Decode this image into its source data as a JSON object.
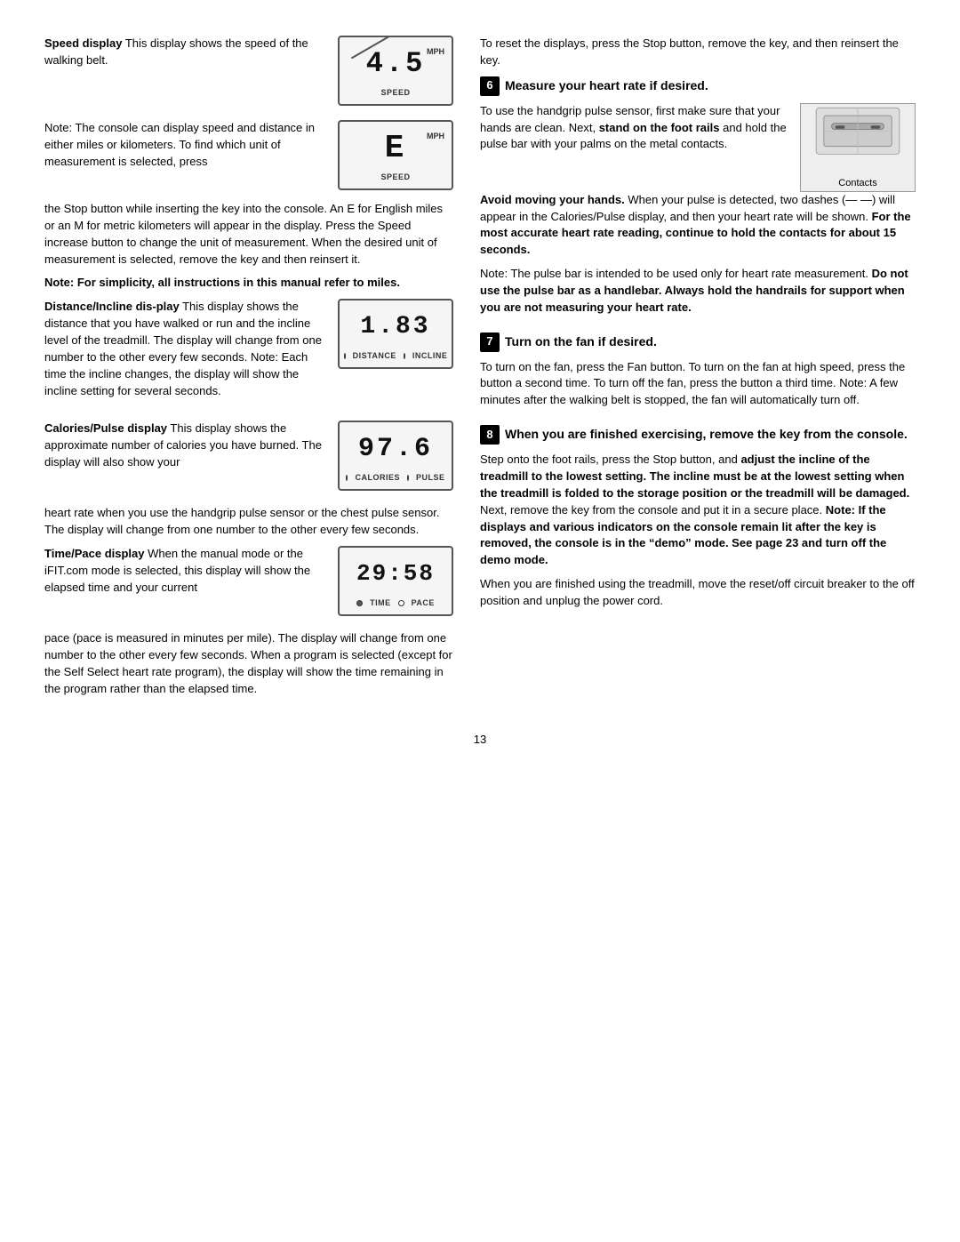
{
  "page": {
    "number": "13"
  },
  "left": {
    "speed_display_heading": "Speed display",
    "speed_display_text": "This display shows the speed of the walking belt.",
    "speed_digits": "4.5",
    "speed_unit": "MPH",
    "speed_label": "SPEED",
    "note_para1": "Note: The console can display speed and distance in either miles or kilometers. To find which unit of measurement is selected, press",
    "e_digits": "E",
    "e_unit": "MPH",
    "e_label": "SPEED",
    "note_para2": "the Stop button while inserting the key into the console. An  E  for English miles or an  M  for metric kilometers will appear in the display. Press the Speed increase button to change the unit of measurement. When the desired unit of measurement is selected, remove the key and then reinsert it.",
    "note_bold": "Note: For simplicity, all instructions in this manual refer to miles.",
    "distance_heading": "Distance/Incline dis-play",
    "distance_text": "This display shows the distance that you have walked or run and the incline level of the treadmill. The display will change from one number to the other every few seconds. Note: Each time the incline changes, the display will show the incline setting for several seconds.",
    "distance_digits": "1.83",
    "distance_label_left": "DISTANCE",
    "distance_label_right": "INCLINE",
    "calories_heading": "Calories/Pulse",
    "calories_subheading": "display",
    "calories_text1": "This display shows the approximate number of calories you have burned. The display will also show your",
    "calories_digits": "97.6",
    "calories_label_left": "CALORIES",
    "calories_label_right": "PULSE",
    "calories_text2": "heart rate when you use the handgrip pulse sensor or the chest pulse sensor. The display will change from one number to the other every few seconds.",
    "time_heading": "Time/Pace display",
    "time_text1": "When the manual mode or the iFIT.com mode is selected, this display will show the elapsed time and your current",
    "time_digits": "29:58",
    "time_label_left": "TIME",
    "time_label_right": "PACE",
    "time_text2": "pace (pace is measured in minutes per mile). The display will change from one number to the other every few seconds. When a program is selected (except for the Self Select heart rate program), the display will show the time remaining in the program rather than the elapsed time."
  },
  "right": {
    "reset_text": "To reset the displays, press the Stop button, remove the key, and then reinsert the key.",
    "step6_label": "6",
    "step6_heading": "Measure your heart rate if desired.",
    "step6_para1": "To use the handgrip pulse sensor, first make sure that your hands are clean. Next,",
    "step6_bold1": "stand on the foot rails",
    "step6_para2": "and hold the pulse bar with your palms on the metal contacts.",
    "contacts_label": "Contacts",
    "step6_bold2": "Avoid moving your hands.",
    "step6_para3": "When your pulse is detected, two dashes (— —) will appear in the Calories/Pulse display, and then your heart rate will be shown.",
    "step6_bold3": "For the most accurate heart rate reading, continue to hold the contacts for about 15 seconds.",
    "pulse_bar_note_bold": "Do not use the pulse bar as a handlebar. Always hold the handrails for support when you are not measuring your heart rate.",
    "pulse_bar_note_prefix": "Note: The pulse bar is intended to be used only for heart rate measurement.",
    "step7_label": "7",
    "step7_heading": "Turn on the fan if desired.",
    "step7_text": "To turn on the fan, press the Fan button. To turn on the fan at high speed, press the button a second time. To turn off the fan, press the button a third time. Note: A few minutes after the walking belt is stopped, the fan will automatically turn off.",
    "step8_label": "8",
    "step8_heading": "When you are finished exercising, remove the key from the console.",
    "step8_para1": "Step onto the foot rails, press the Stop button, and",
    "step8_bold1": "adjust the incline of the treadmill to the lowest setting. The incline must be at the lowest setting when the treadmill is folded to the storage position or the treadmill will be damaged.",
    "step8_para2": "Next, remove the key from the console and put it in a secure place.",
    "step8_bold2": "Note: If the displays and various indicators on the console remain lit after the key is removed, the console is in the “demo” mode. See page 23 and turn off the demo mode.",
    "step8_para3": "When you are finished using the treadmill, move the reset/off circuit breaker to the off position and unplug the power cord."
  }
}
